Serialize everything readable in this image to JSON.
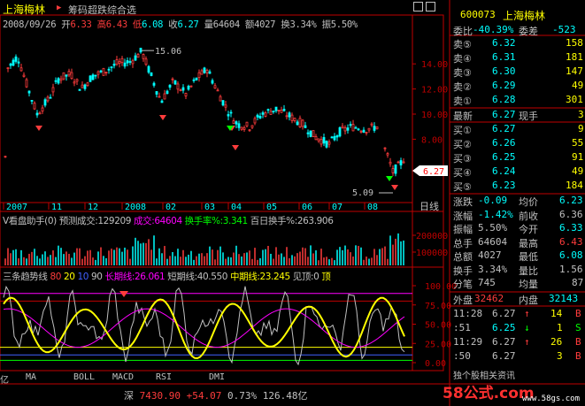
{
  "header": {
    "name": "上海梅林",
    "indicator_name": "筹码超跌综合选",
    "date": "2008/09/26",
    "open_label": "开",
    "open": "6.33",
    "high_label": "高",
    "high": "6.43",
    "low_label": "低",
    "low": "6.08",
    "close_label": "收",
    "close": "6.27",
    "volume_label": "量",
    "volume": "64604",
    "amount_label": "额",
    "amount": "4027",
    "turnover_label": "换",
    "turnover": "3.34%",
    "amplitude_label": "振",
    "amplitude": "5.50%"
  },
  "price_chart": {
    "high_mark": "15.06",
    "low_mark": "5.09",
    "last_price_tag": "6.27",
    "y_ticks": [
      "14.00",
      "12.00",
      "10.00",
      "8.00"
    ],
    "x_ticks": [
      "2007",
      "11",
      "12",
      "2008",
      "02",
      "03",
      "04",
      "05",
      "06",
      "07",
      "08"
    ],
    "period": "日线"
  },
  "volume_chart": {
    "title": "V看盘助手(0)",
    "predict_label": "预测成交",
    "predict_value": "129209",
    "volume_label": "成交",
    "volume_value": "64604",
    "turnover_label": "换手率%",
    "turnover_value": "3.341",
    "hundred_label": "百日换手%",
    "hundred_value": "263.906",
    "y_ticks": [
      "200000",
      "100000"
    ]
  },
  "trend_chart": {
    "title": "三条趋势线",
    "levels": [
      "80",
      "20",
      "10",
      "90"
    ],
    "long_label": "长期线",
    "long_value": "26.061",
    "short_label": "短期线",
    "short_value": "40.550",
    "mid_label": "中期线",
    "mid_value": "23.245",
    "signal_text": "见顶:0",
    "signal_text2": "顶",
    "y_ticks": [
      "100.00",
      "75.00",
      "50.00",
      "25.00",
      "0.00"
    ]
  },
  "tabs": [
    "MA",
    "BOLL",
    "MACD",
    "RSI",
    "DMI"
  ],
  "status_bar": {
    "left": "亿",
    "index_name": "深",
    "index_value": "7430.90",
    "index_change": "+54.07",
    "index_pct": "0.73%",
    "index_amount": "126.48亿",
    "watermark": "58公式.com",
    "watermark_url": "www.58gs.com"
  },
  "quote_panel": {
    "code": "600073",
    "name": "上海梅林",
    "ratio_label": "委比",
    "ratio": "-40.39%",
    "diff_label": "委差",
    "diff": "-523",
    "sells": [
      {
        "label": "卖⑤",
        "price": "6.32",
        "vol": "158"
      },
      {
        "label": "卖④",
        "price": "6.31",
        "vol": "181"
      },
      {
        "label": "卖③",
        "price": "6.30",
        "vol": "147"
      },
      {
        "label": "卖②",
        "price": "6.29",
        "vol": "49"
      },
      {
        "label": "卖①",
        "price": "6.28",
        "vol": "301"
      }
    ],
    "last_label": "最新",
    "last": "6.27",
    "current_label": "现手",
    "current": "3",
    "buys": [
      {
        "label": "买①",
        "price": "6.27",
        "vol": "9"
      },
      {
        "label": "买②",
        "price": "6.26",
        "vol": "55"
      },
      {
        "label": "买③",
        "price": "6.25",
        "vol": "91"
      },
      {
        "label": "买④",
        "price": "6.24",
        "vol": "49"
      },
      {
        "label": "买⑤",
        "price": "6.23",
        "vol": "184"
      }
    ],
    "stats": [
      {
        "l1": "涨跌",
        "v1": "-0.09",
        "l2": "均价",
        "v2": "6.23"
      },
      {
        "l1": "涨幅",
        "v1": "-1.42%",
        "l2": "前收",
        "v2": "6.36"
      },
      {
        "l1": "振幅",
        "v1": "5.50%",
        "l2": "今开",
        "v2": "6.33"
      },
      {
        "l1": "总手",
        "v1": "64604",
        "l2": "最高",
        "v2": "6.43"
      },
      {
        "l1": "总额",
        "v1": "4027",
        "l2": "最低",
        "v2": "6.08"
      },
      {
        "l1": "换手",
        "v1": "3.34%",
        "l2": "量比",
        "v2": "1.56"
      },
      {
        "l1": "分笔",
        "v1": "745",
        "l2": "均量",
        "v2": "87"
      }
    ],
    "outer_label": "外盘",
    "outer": "32462",
    "inner_label": "内盘",
    "inner": "32143",
    "ticks": [
      {
        "time": "11:28",
        "price": "6.27",
        "arrow": "↑",
        "vol": "14",
        "side": "B"
      },
      {
        "time": ":51",
        "price": "6.25",
        "arrow": "↓",
        "vol": "1",
        "side": "S"
      },
      {
        "time": "11:29",
        "price": "6.27",
        "arrow": "↑",
        "vol": "26",
        "side": "B"
      },
      {
        "time": ":50",
        "price": "6.27",
        "arrow": "",
        "vol": "3",
        "side": "B"
      }
    ],
    "bottom_text": "独个股相关资讯"
  },
  "colors": {
    "up": "#ff3c3c",
    "down": "#00ffff",
    "flat": "#c0c0c0",
    "frame": "#c00000",
    "yellow": "#ffff00",
    "magenta": "#ff00ff",
    "green": "#00ff00"
  }
}
